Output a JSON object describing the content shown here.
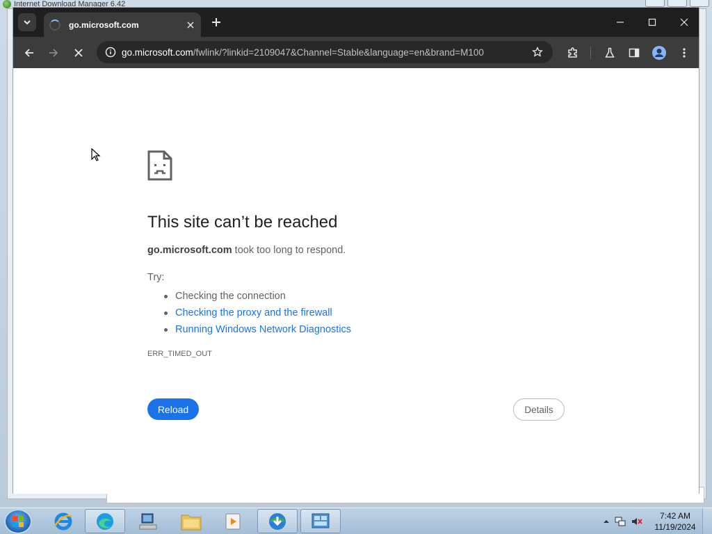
{
  "background_window": {
    "title": "Internet Download Manager 6.42"
  },
  "browser": {
    "tab": {
      "title": "go.microsoft.com"
    },
    "omnibox": {
      "host": "go.microsoft.com",
      "path": "/fwlink/?linkid=2109047&Channel=Stable&language=en&brand=M100"
    }
  },
  "error_page": {
    "title": "This site can’t be reached",
    "host": "go.microsoft.com",
    "description_suffix": " took too long to respond.",
    "try_label": "Try:",
    "suggestions": [
      {
        "text": "Checking the connection",
        "is_link": false
      },
      {
        "text": "Checking the proxy and the firewall",
        "is_link": true
      },
      {
        "text": "Running Windows Network Diagnostics",
        "is_link": true
      }
    ],
    "error_code": "ERR_TIMED_OUT",
    "reload_label": "Reload",
    "details_label": "Details"
  },
  "taskbar": {
    "clock_time": "7:42 AM",
    "clock_date": "11/19/2024"
  },
  "colors": {
    "link": "#1a73e8",
    "primary_button": "#1a73e8",
    "browser_frame": "#1f1f1f",
    "toolbar": "#3c3c3c"
  }
}
